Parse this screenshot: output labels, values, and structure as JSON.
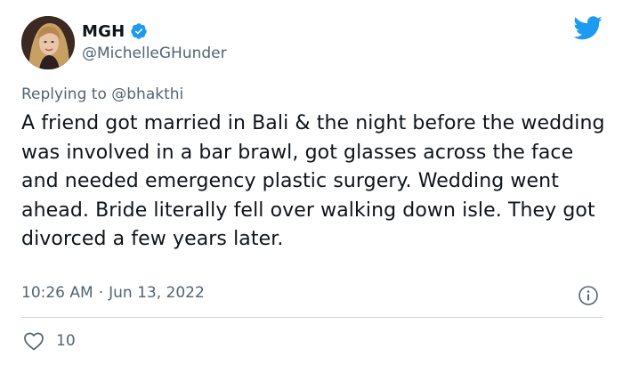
{
  "author": {
    "display_name": "MGH",
    "handle": "@MichelleGHunder",
    "verified_icon": "verified-badge-icon",
    "avatar_icon": "avatar"
  },
  "brand": {
    "icon": "twitter-bird-icon",
    "accent_color": "#1d9bf0"
  },
  "reply": {
    "prefix": "Replying to",
    "handle": "@bhakthi"
  },
  "tweet": {
    "text": "A friend got married in Bali & the night before the wedding was involved in a bar brawl, got glasses across the face and needed emergency plastic surgery. Wedding went ahead. Bride literally fell over walking down isle. They got divorced a few years later."
  },
  "meta": {
    "time": "10:26 AM",
    "separator": "·",
    "date": "Jun 13, 2022",
    "info_icon": "info-icon"
  },
  "engagement": {
    "like_icon": "heart-icon",
    "like_count": "10"
  },
  "colors": {
    "text_primary": "#0f1419",
    "text_secondary": "#536471",
    "divider": "#cfd9de"
  }
}
